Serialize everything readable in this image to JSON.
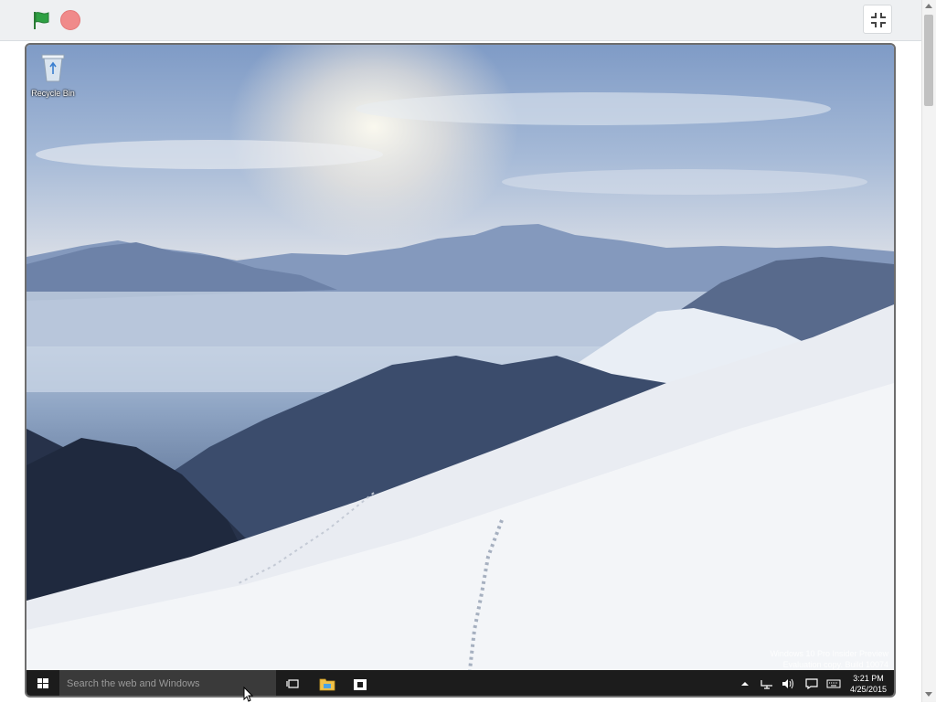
{
  "viewer": {
    "green_flag": "green-flag-icon",
    "stop": "stop-icon",
    "fullscreen": "exit-fullscreen-icon"
  },
  "desktop": {
    "icons": [
      {
        "label": "Recycle Bin",
        "icon": "recycle-bin-icon"
      }
    ],
    "watermark": {
      "line1": "Windows 10 Pro Insider Preview",
      "line2": "Evaluation copy. Build 10074"
    }
  },
  "taskbar": {
    "start_icon": "windows-start-icon",
    "search_placeholder": "Search the web and Windows",
    "pinned": [
      "task-view-icon",
      "file-explorer-icon",
      "store-icon"
    ],
    "tray": [
      "chevron-up-icon",
      "network-icon",
      "volume-icon",
      "action-center-icon",
      "keyboard-icon"
    ],
    "time": "3:21 PM",
    "date": "4/25/2015"
  },
  "colors": {
    "taskbar": "#1c1c1c",
    "search_bg": "#3a3a3a",
    "flag_green": "#2ea043",
    "stop_red": "#f08a8a"
  }
}
